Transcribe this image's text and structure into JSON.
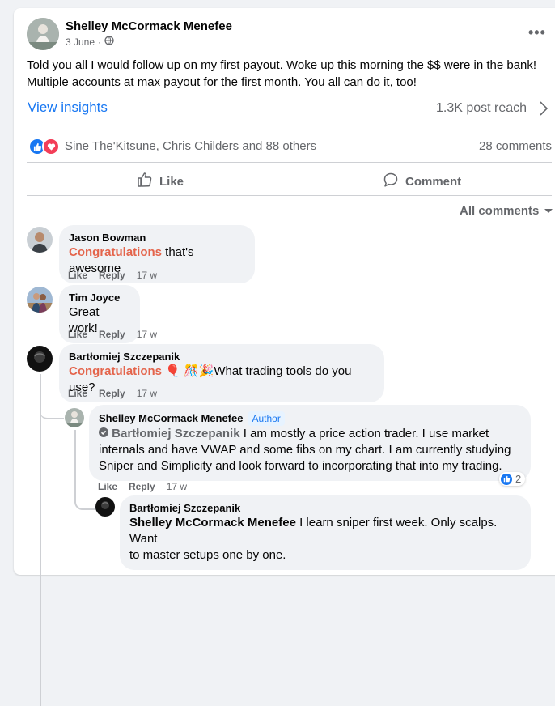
{
  "post": {
    "author": "Shelley McCormack Menefee",
    "date": "3 June",
    "text_line1": "Told you all I would follow up on my first payout.  Woke up this morning the $$ were in the bank!",
    "text_line2": "Multiple accounts at max payout for the first month.  You all can do it, too!",
    "view_insights": "View insights",
    "post_reach": "1.3K post reach",
    "reactors": "Sine The'Kitsune, Chris Childers and 88 others",
    "comments_count": "28 comments",
    "like_label": "Like",
    "comment_label": "Comment",
    "all_comments": "All comments"
  },
  "comments": [
    {
      "name": "Jason Bowman",
      "highlight": "Congratulations",
      "text": " that's awesome",
      "like": "Like",
      "reply": "Reply",
      "time": "17 w"
    },
    {
      "name": "Tim Joyce",
      "text": "Great work!",
      "like": "Like",
      "reply": "Reply",
      "time": "17 w"
    },
    {
      "name": "Bartłomiej Szczepanik",
      "highlight": "Congratulations",
      "emoji": "🎈 🎊🎉",
      "text": "What trading tools do you use?",
      "like": "Like",
      "reply": "Reply",
      "time": "17 w"
    }
  ],
  "replies": [
    {
      "name": "Shelley McCormack Menefee",
      "badge": "Author",
      "mention": "Bartłomiej Szczepanik",
      "line1": " I am mostly a price action trader. I use market",
      "line2": "internals and have VWAP and some fibs on my chart. I am currently studying",
      "line3": "Sniper and Simplicity and look forward to incorporating that into my trading.",
      "like_count": "2",
      "like": "Like",
      "reply": "Reply",
      "time": "17 w"
    },
    {
      "name": "Bartłomiej Szczepanik",
      "mention": "Shelley McCormack Menefee",
      "line1": " I learn sniper first week. Only scalps. Want",
      "line2": "to master setups one by one."
    }
  ],
  "colors": {
    "accent": "#1877f2",
    "highlight": "#e4644b",
    "muted": "#65676b"
  }
}
